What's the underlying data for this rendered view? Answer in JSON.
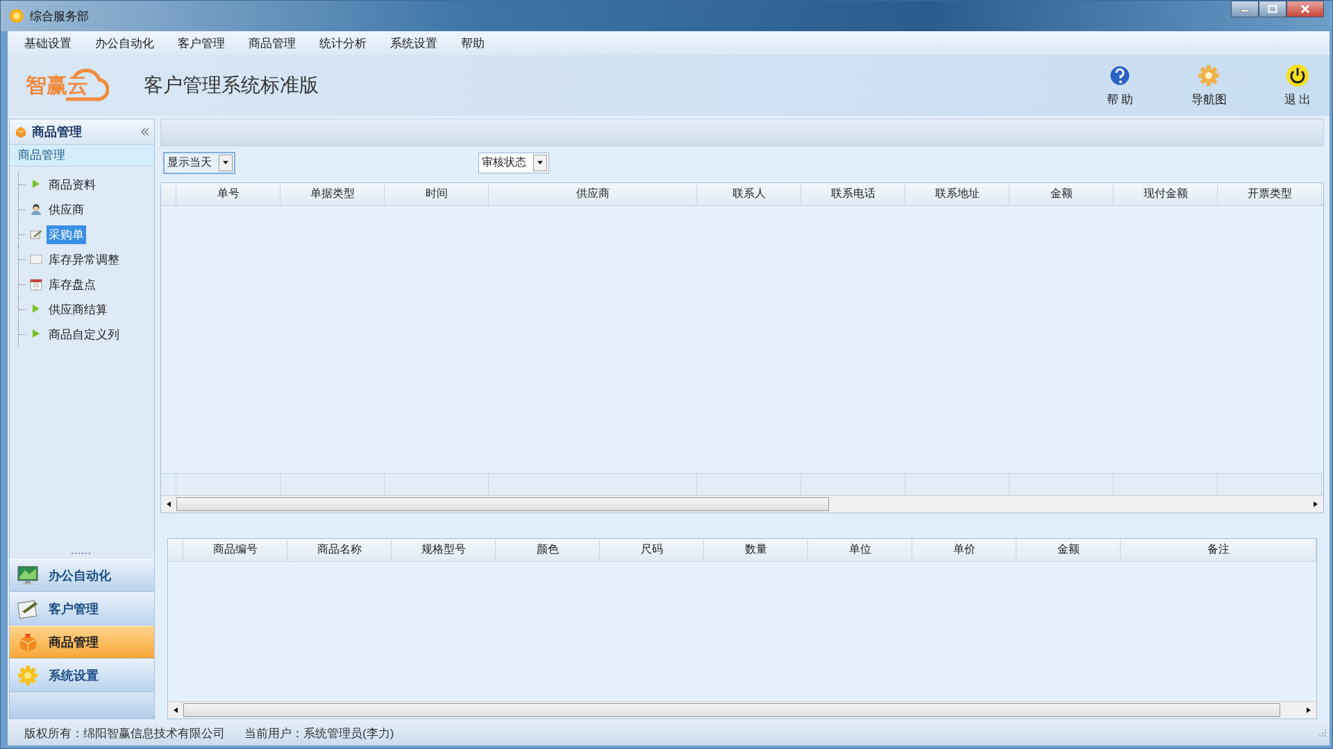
{
  "window": {
    "title": "综合服务部"
  },
  "menu": [
    "基础设置",
    "办公自动化",
    "客户管理",
    "商品管理",
    "统计分析",
    "系统设置",
    "帮助"
  ],
  "header": {
    "logo": "智赢云",
    "title": "客户管理系统标准版"
  },
  "toolbar": [
    {
      "label": "帮 助"
    },
    {
      "label": "导航图"
    },
    {
      "label": "退 出"
    }
  ],
  "sidebar": {
    "title": "商品管理",
    "section": "商品管理",
    "items": [
      {
        "label": "商品资料",
        "selected": false
      },
      {
        "label": "供应商",
        "selected": false
      },
      {
        "label": "采购单",
        "selected": true
      },
      {
        "label": "库存异常调整",
        "selected": false
      },
      {
        "label": "库存盘点",
        "selected": false
      },
      {
        "label": "供应商结算",
        "selected": false
      },
      {
        "label": "商品自定义列",
        "selected": false
      }
    ],
    "nav": [
      {
        "label": "办公自动化",
        "selected": false
      },
      {
        "label": "客户管理",
        "selected": false
      },
      {
        "label": "商品管理",
        "selected": true
      },
      {
        "label": "系统设置",
        "selected": false
      }
    ]
  },
  "filters": [
    {
      "value": "显示当天"
    },
    {
      "value": "审核状态"
    }
  ],
  "orders_table": {
    "columns": [
      "单号",
      "单据类型",
      "时间",
      "供应商",
      "联系人",
      "联系电话",
      "联系地址",
      "金额",
      "现付金额",
      "开票类型"
    ]
  },
  "details_table": {
    "columns": [
      "商品编号",
      "商品名称",
      "规格型号",
      "颜色",
      "尺码",
      "数量",
      "单位",
      "单价",
      "金额",
      "备注"
    ]
  },
  "status_bar": [
    "版权所有：绵阳智赢信息技术有限公司",
    "当前用户：系统管理员(李力)"
  ]
}
